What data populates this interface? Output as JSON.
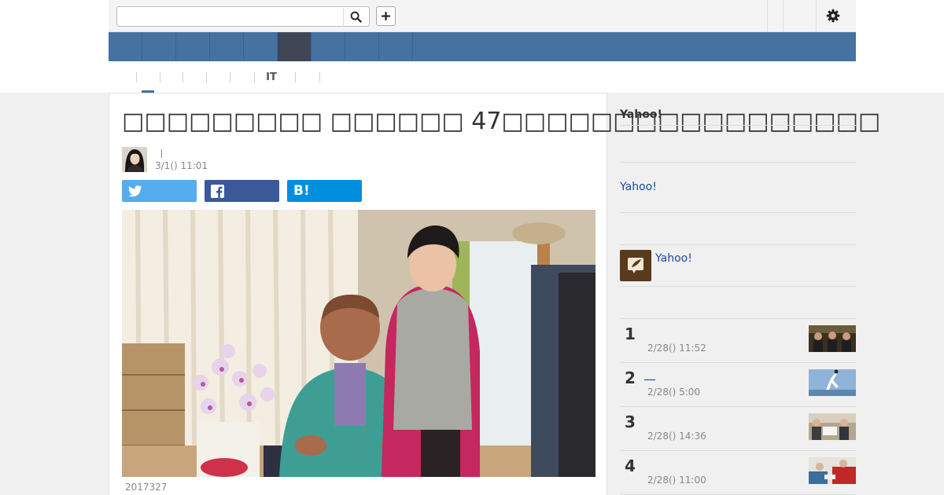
{
  "header": {
    "search": {
      "value": "",
      "placeholder": ""
    },
    "icons": {
      "search": "search-icon",
      "add": "plus-icon",
      "settings": "gear-icon"
    }
  },
  "global_nav": {
    "items": [
      {
        "label": "",
        "active": false
      },
      {
        "label": "",
        "active": false
      },
      {
        "label": "",
        "active": false
      },
      {
        "label": "",
        "active": false
      },
      {
        "label": "",
        "active": false
      },
      {
        "label": "",
        "active": true
      },
      {
        "label": "",
        "active": false
      },
      {
        "label": "",
        "active": false
      },
      {
        "label": "",
        "active": false
      }
    ]
  },
  "sub_nav": {
    "items": [
      "",
      "",
      "",
      "",
      "",
      "IT",
      "",
      ""
    ]
  },
  "article": {
    "title": "□□□□□□□□□ □□□□□□ 47□□□□□□□□□□□□□□□□□",
    "author_name": "",
    "date": "3/1() 11:01",
    "share": {
      "twitter": "",
      "facebook": "",
      "hatena_icon": "B!"
    },
    "photo_caption": "2017327"
  },
  "sidebar": {
    "heading": "Yahoo!",
    "link": "Yahoo!",
    "promo_text": "Yahoo!",
    "ranking": [
      {
        "rank": "1",
        "title": "",
        "date": "2/28() 11:52",
        "thumb_color": "#3a3020"
      },
      {
        "rank": "2",
        "title": "—",
        "date": "2/28() 5:00",
        "thumb_color": "#8fb4d8"
      },
      {
        "rank": "3",
        "title": "",
        "date": "2/28() 14:36",
        "thumb_color": "#9a8a70"
      },
      {
        "rank": "4",
        "title": "",
        "date": "2/28() 11:00",
        "thumb_color": "#c02828"
      }
    ]
  },
  "colors": {
    "nav_blue": "#4572a1",
    "nav_active": "#3e4656",
    "twitter": "#55acee",
    "facebook": "#3b5998",
    "hatena": "#008fde",
    "link": "#1a4a9c"
  }
}
